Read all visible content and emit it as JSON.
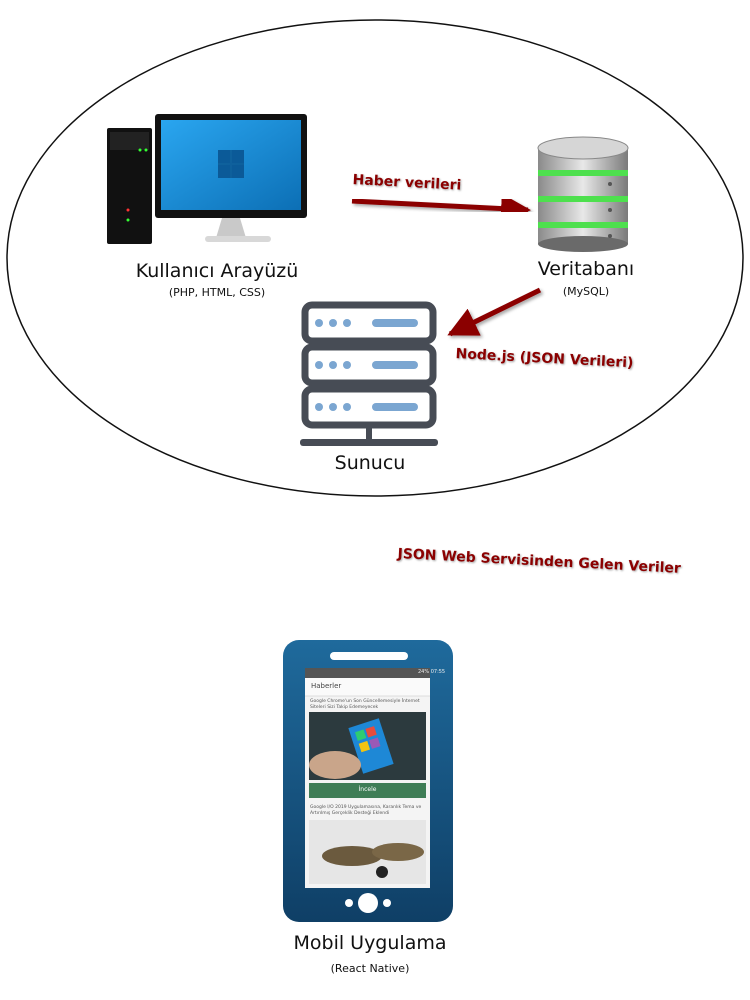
{
  "nodes": {
    "ui": {
      "title": "Kullanıcı Arayüzü",
      "subtitle": "(PHP, HTML, CSS)"
    },
    "db": {
      "title": "Veritabanı",
      "subtitle": "(MySQL)"
    },
    "server": {
      "title": "Sunucu"
    },
    "mobile": {
      "title": "Mobil Uygulama",
      "subtitle": "(React Native)"
    }
  },
  "arrows": {
    "news_data": "Haber verileri",
    "nodejs": "Node.js (JSON Verileri)",
    "json_service": "JSON Web Servisinden Gelen Veriler"
  },
  "phone": {
    "app_title": "Haberler",
    "status": "24% 07:55",
    "news1": "Google Chrome'un Son Güncellemesiyle İnternet Siteleri Sizi Takip Edemeyecek",
    "button": "İncele",
    "news2": "Google I/O 2019 Uygulamasına, Karanlık Tema ve Artırılmış Gerçeklik Desteği Eklendi"
  },
  "colors": {
    "arrow": "#8b0000",
    "monitor_screen": "#1a8fd6",
    "server_dark": "#474c55",
    "server_light": "#7ba6d1",
    "db_green": "#4ee04e",
    "phone_body": "#1a5b8a",
    "button_green": "#3f7d56"
  },
  "icons": [
    "desktop-computer-icon",
    "database-icon",
    "server-rack-icon",
    "smartphone-icon"
  ]
}
